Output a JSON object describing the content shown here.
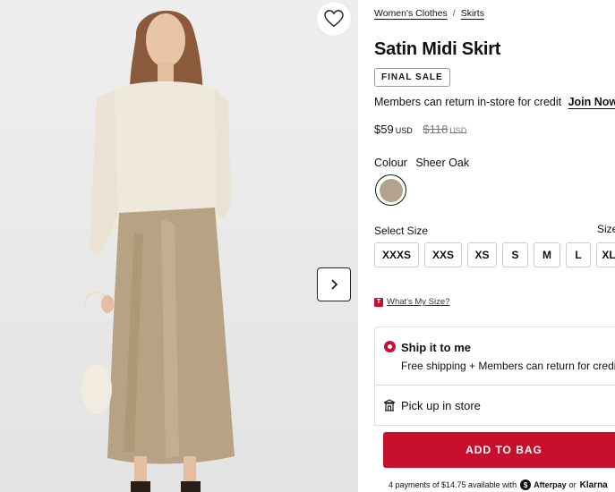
{
  "breadcrumbs": [
    "Women's Clothes",
    "Skirts"
  ],
  "breadcrumb_sep": "/",
  "product": {
    "title": "Satin Midi Skirt",
    "badge": "FINAL SALE",
    "members_text": "Members can return in-store for credit",
    "join_link": "Join Now",
    "price": "$59",
    "price_currency": "USD",
    "original_price": "$118",
    "original_currency": "USD"
  },
  "colour": {
    "label": "Colour",
    "value": "Sheer Oak",
    "swatch_color": "#b3a28c"
  },
  "size": {
    "select_label": "Select Size",
    "guide_label": "Size",
    "options": [
      "XXXS",
      "XXS",
      "XS",
      "S",
      "M",
      "L",
      "XL"
    ],
    "whats_my_size": "What's My Size?"
  },
  "fulfillment": {
    "ship_title": "Ship it to me",
    "ship_sub": "Free shipping + Members can return for credit",
    "pickup_title": "Pick up in store"
  },
  "cta": {
    "add_to_bag": "ADD TO BAG"
  },
  "installments": {
    "text": "4 payments of $14.75 available with",
    "afterpay": "Afterpay",
    "or": "or",
    "klarna": "Klarna"
  },
  "colors": {
    "accent": "#c8102e"
  }
}
